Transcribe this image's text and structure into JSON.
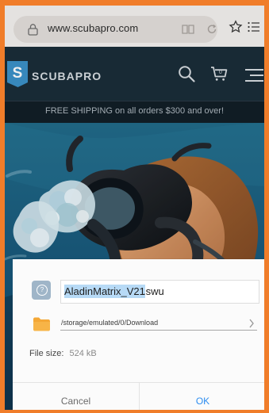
{
  "browser": {
    "url": "www.scubapro.com",
    "icons": {
      "lock": "lock-icon",
      "reader": "reader-mode-icon",
      "reload": "reload-icon",
      "bookmark": "star-icon",
      "menu": "menu-list-icon"
    }
  },
  "site": {
    "logo_letter": "S",
    "brand_name": "SCUBAPRO",
    "icons": {
      "search": "search-icon",
      "cart": "cart-icon",
      "menu": "hamburger-icon"
    },
    "cart_count": "0",
    "shipping_banner": "FREE SHIPPING on all orders $300 and over!"
  },
  "dialog": {
    "filename_base": "AladinMatrix_V21",
    "filename_ext": ".swu",
    "path": "/storage/emulated/0/Download",
    "file_size_label": "File size:",
    "file_size_value": "524 kB",
    "cancel_label": "Cancel",
    "ok_label": "OK"
  },
  "colors": {
    "frame_orange": "#f07d2a",
    "accent_blue": "#2d8df0",
    "selection_blue": "#b7daf6",
    "folder_orange": "#f4a735",
    "brand_blue": "#3b91c8"
  }
}
